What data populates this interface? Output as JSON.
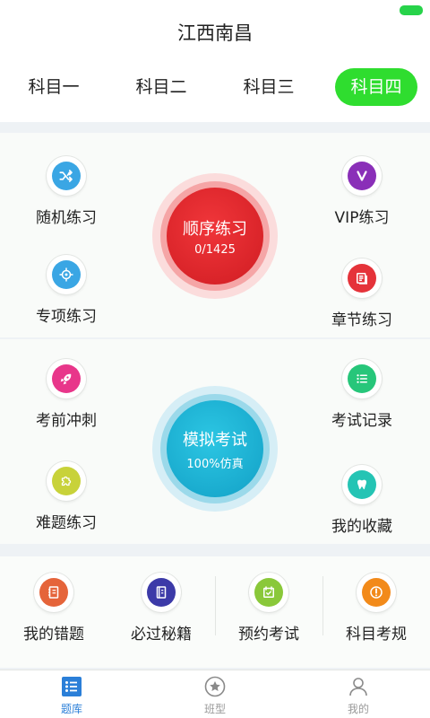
{
  "header": {
    "title": "江西南昌"
  },
  "tabs": [
    "科目一",
    "科目二",
    "科目三",
    "科目四"
  ],
  "practice": {
    "random": "随机练习",
    "special": "专项练习",
    "vip": "VIP练习",
    "chapter": "章节练习",
    "sequence": {
      "title": "顺序练习",
      "progress": "0/1425"
    }
  },
  "exam": {
    "sprint": "考前冲刺",
    "hard": "难题练习",
    "record": "考试记录",
    "favorites": "我的收藏",
    "mock": {
      "title": "模拟考试",
      "subtitle": "100%仿真"
    }
  },
  "tools": {
    "mistakes": "我的错题",
    "secrets": "必过秘籍",
    "booking": "预约考试",
    "rules": "科目考规"
  },
  "nav": {
    "library": "题库",
    "class": "班型",
    "mine": "我的"
  },
  "colors": {
    "accent_green": "#2fdd2f",
    "red": "#e3262a",
    "cyan": "#1fb4d4",
    "nav_active": "#2b7fd8"
  }
}
